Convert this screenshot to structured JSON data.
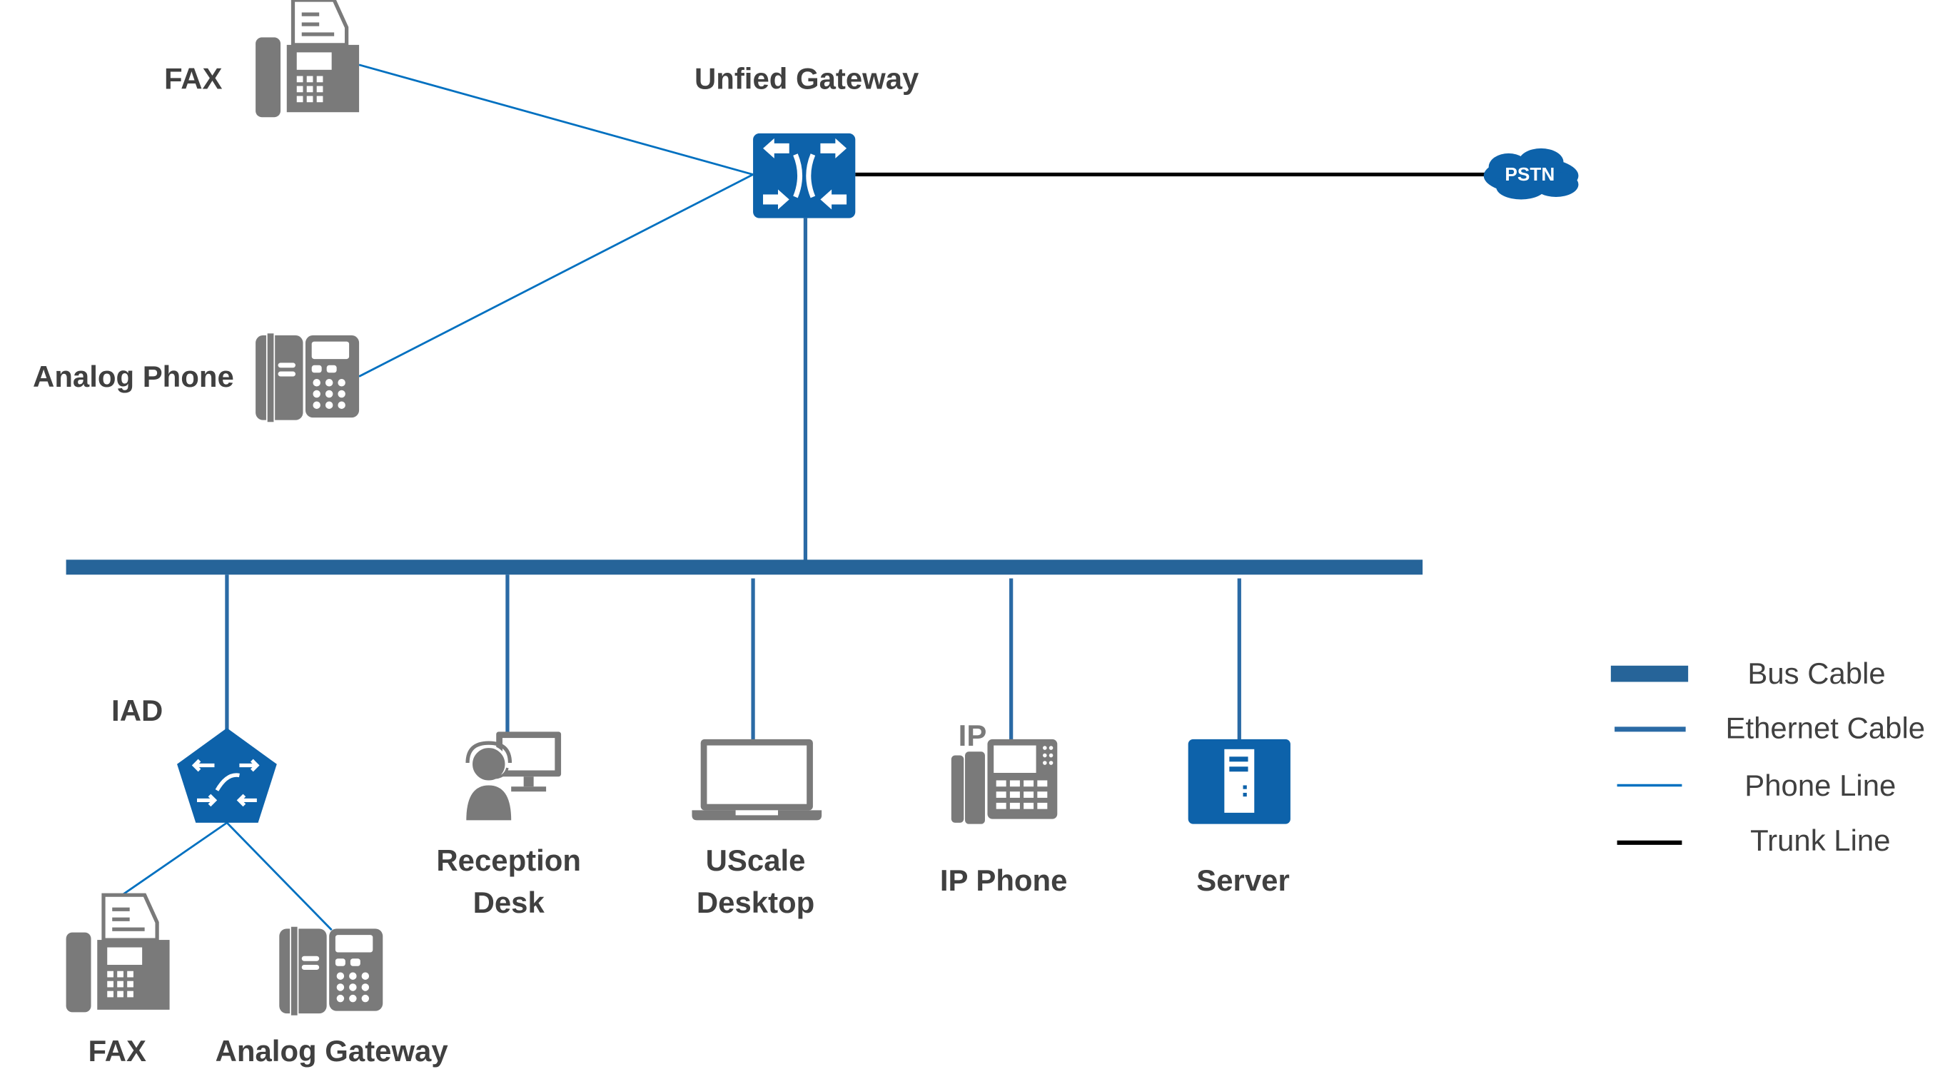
{
  "nodes": {
    "fax_top": "FAX",
    "unified_gateway": "Unfied Gateway",
    "analog_phone": "Analog Phone",
    "pstn": "PSTN",
    "iad": "IAD",
    "fax_bottom": "FAX",
    "analog_gateway": "Analog Gateway",
    "reception_desk": [
      "Reception",
      "Desk"
    ],
    "uscale_desktop": [
      "UScale",
      "Desktop"
    ],
    "ip_phone": "IP Phone",
    "ip_badge": "IP",
    "server": "Server"
  },
  "legend": [
    {
      "label": "Bus Cable",
      "color": "#266499"
    },
    {
      "label": "Ethernet Cable",
      "color": "#2a6aa5"
    },
    {
      "label": "Phone Line",
      "color": "#0070c0"
    },
    {
      "label": "Trunk Line",
      "color": "#000000"
    }
  ],
  "colors": {
    "device_blue": "#0d62aa",
    "icon_gray": "#7a7a7a",
    "text": "#404040"
  }
}
